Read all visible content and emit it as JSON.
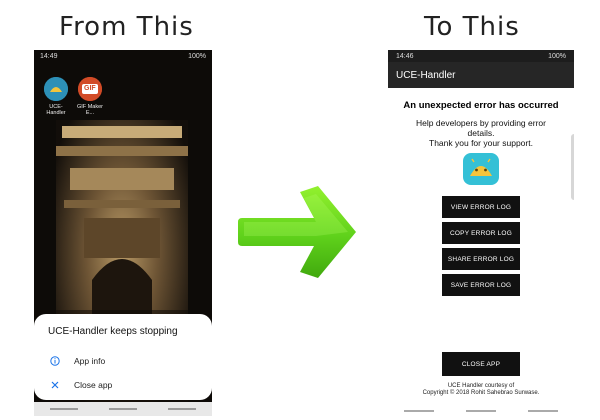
{
  "captions": {
    "left": "From This",
    "right": "To This"
  },
  "left_phone": {
    "status": {
      "time": "14:49",
      "battery": "100%"
    },
    "home_icons": [
      {
        "label": "UCE-Handler"
      },
      {
        "label": "GIF Maker E..."
      }
    ],
    "gif_badge": "GIF",
    "dialog": {
      "title": "UCE-Handler keeps stopping",
      "items": [
        {
          "icon": "info-icon",
          "label": "App info"
        },
        {
          "icon": "close-icon",
          "label": "Close app"
        }
      ]
    }
  },
  "right_phone": {
    "status": {
      "time": "14:46",
      "battery": "100%"
    },
    "toolbar_title": "UCE-Handler",
    "error_title": "An unexpected error has occurred",
    "error_text_1": "Help developers by providing error details.",
    "error_text_2": "Thank you for your support.",
    "buttons": [
      {
        "label": "VIEW ERROR LOG"
      },
      {
        "label": "COPY ERROR LOG"
      },
      {
        "label": "SHARE ERROR LOG"
      },
      {
        "label": "SAVE ERROR LOG"
      }
    ],
    "close_label": "CLOSE APP",
    "footer_1": "UCE Handler courtesy of",
    "footer_2": "Copyright © 2018 Rohit Sahebrao Surwase."
  },
  "colors": {
    "arrow_green": "#6ad61e",
    "dialog_accent": "#1a73e8",
    "badge_cyan": "#34c0d6",
    "button_black": "#111111"
  }
}
